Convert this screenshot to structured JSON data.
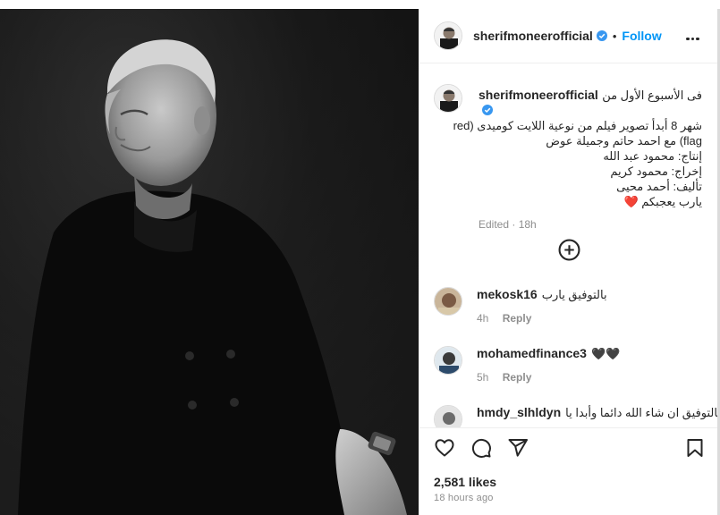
{
  "post": {
    "username": "sherifmoneerofficial",
    "follow_label": "Follow",
    "dot": "•",
    "caption_lines": [
      "فى الأسبوع الأول من",
      "شهر 8 أبدأ تصوير فيلم من نوعية اللايت كوميدى (red",
      "flag) مع احمد حاتم وجميلة عوض",
      "إنتاج: محمود عبد الله",
      "إخراج: محمود كريم",
      "تأليف: أحمد محيى",
      "يارب يعجبكم ❤️"
    ],
    "caption_meta": "Edited · 18h",
    "likes": "2,581 likes",
    "time_ago": "18 hours ago"
  },
  "comments": [
    {
      "username": "mekosk16",
      "text": "بالتوفيق يارب",
      "age": "4h",
      "reply_label": "Reply"
    },
    {
      "username": "mohamedfinance3",
      "text": "🖤🖤",
      "age": "5h",
      "reply_label": "Reply"
    },
    {
      "username": "hmdy_slhldyn",
      "text": "بالتوفيق ان شاء الله دائما وأبدا يا",
      "age": "",
      "reply_label": ""
    }
  ],
  "colors": {
    "follow": "#0095f6",
    "verified": "#3897f0",
    "muted": "#8e8e8e"
  },
  "icons": [
    "verified-badge-icon",
    "more-options-icon",
    "add-circle-icon",
    "heart-icon",
    "comment-icon",
    "share-icon",
    "bookmark-icon"
  ]
}
